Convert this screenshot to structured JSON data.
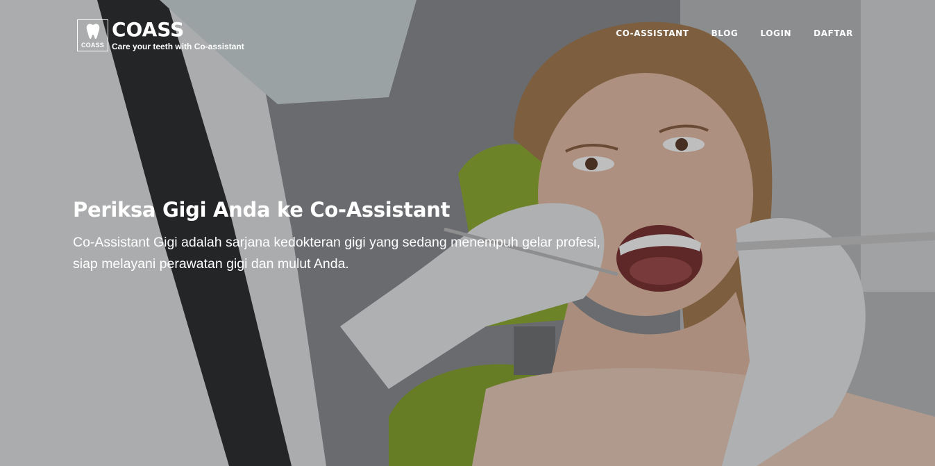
{
  "brand": {
    "mini_label": "COASS",
    "name": "COASS",
    "tagline": "Care your teeth with Co-assistant"
  },
  "nav": {
    "items": [
      {
        "label": "CO-ASSISTANT"
      },
      {
        "label": "BLOG"
      },
      {
        "label": "LOGIN"
      },
      {
        "label": "DAFTAR"
      }
    ]
  },
  "hero": {
    "headline": "Periksa Gigi Anda ke Co-Assistant",
    "description": "Co-Assistant Gigi adalah sarjana kedokteran gigi yang sedang menempuh gelar profesi, siap melayani perawatan gigi dan mulut Anda."
  },
  "colors": {
    "text": "#ffffff",
    "chair_green": "#8fae2e",
    "glove": "#e9ecee"
  }
}
